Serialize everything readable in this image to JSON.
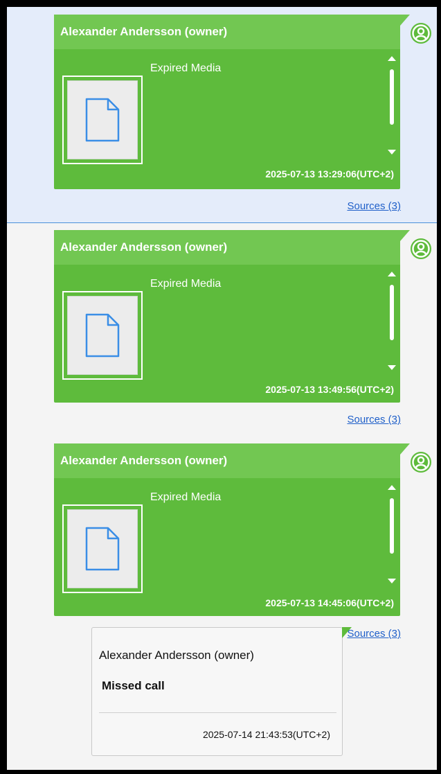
{
  "messages": [
    {
      "sender": "Alexander Andersson (owner)",
      "media_label": "Expired Media",
      "timestamp": "2025-07-13 13:29:06(UTC+2)",
      "sources": "Sources (3)",
      "selected": true
    },
    {
      "sender": "Alexander Andersson (owner)",
      "media_label": "Expired Media",
      "timestamp": "2025-07-13 13:49:56(UTC+2)",
      "sources": "Sources (3)",
      "selected": false
    },
    {
      "sender": "Alexander Andersson (owner)",
      "media_label": "Expired Media",
      "timestamp": "2025-07-13 14:45:06(UTC+2)",
      "sources": "Sources (3)",
      "selected": false
    }
  ],
  "call": {
    "sender": "Alexander Andersson (owner)",
    "text": "Missed call",
    "timestamp": "2025-07-14 21:43:53(UTC+2)"
  },
  "icons": {
    "avatar": "user-avatar-icon",
    "media": "file-icon"
  },
  "colors": {
    "bubble": "#5ebb3c",
    "header": "#72c752",
    "selected_row": "#e4ecfa",
    "link": "#1f5fc9"
  }
}
